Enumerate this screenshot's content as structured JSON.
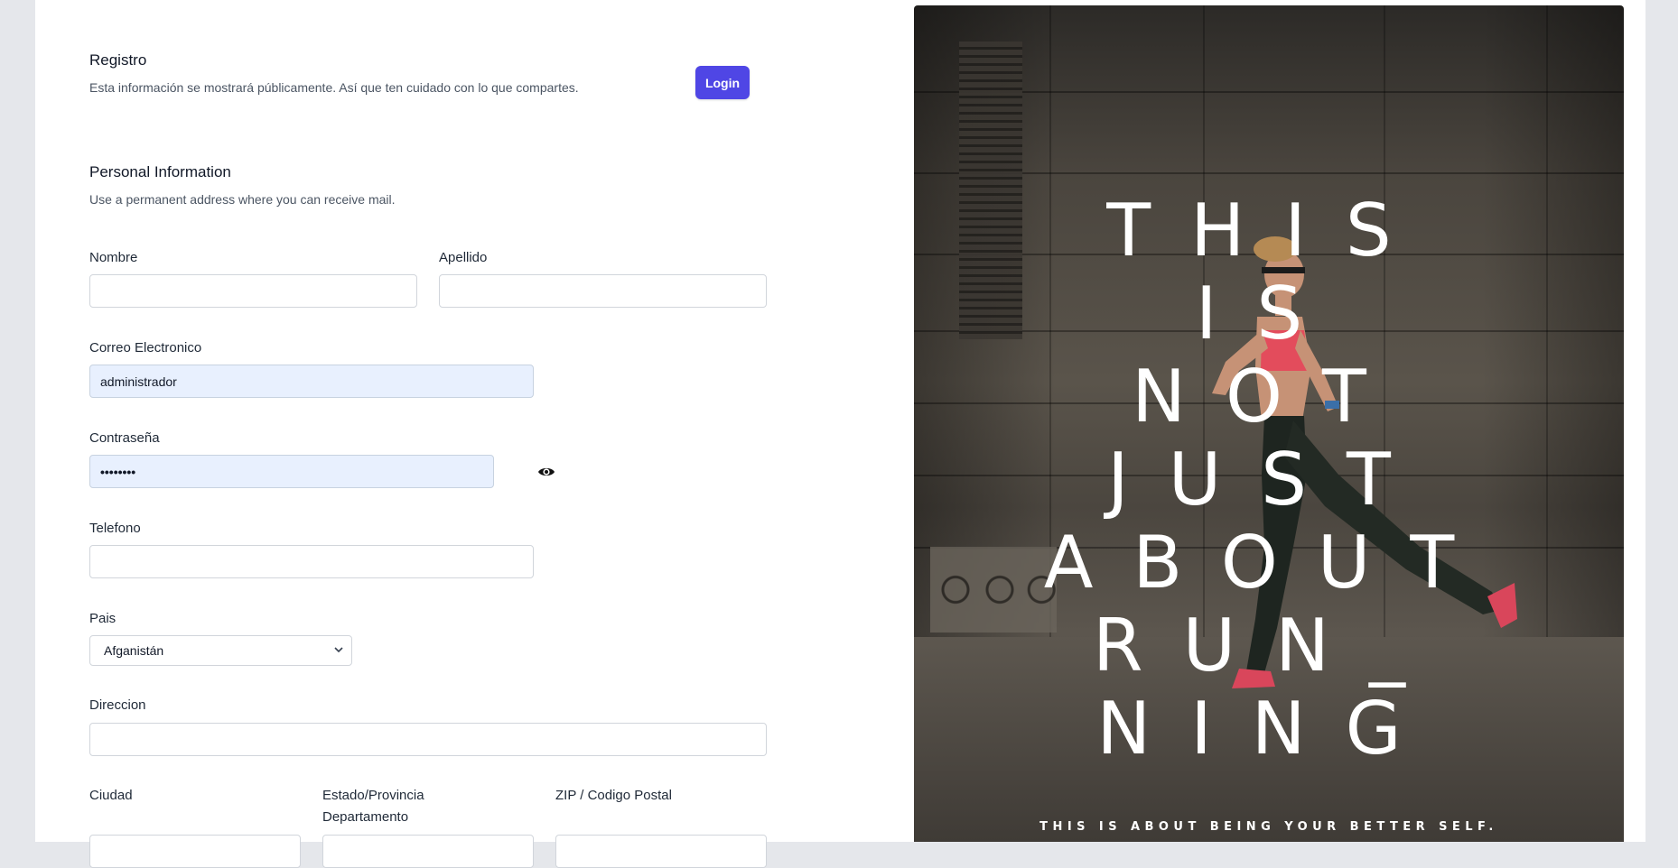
{
  "header": {
    "title": "Registro",
    "subtitle": "Esta información se mostrará públicamente. Así que ten cuidado con lo que compartes.",
    "login_label": "Login"
  },
  "section": {
    "title": "Personal Information",
    "subtitle": "Use a permanent address where you can receive mail."
  },
  "fields": {
    "nombre": {
      "label": "Nombre",
      "value": ""
    },
    "apellido": {
      "label": "Apellido",
      "value": ""
    },
    "correo": {
      "label": "Correo Electronico",
      "value": "administrador"
    },
    "contrasena": {
      "label": "Contraseña",
      "value": "••••••••"
    },
    "telefono": {
      "label": "Telefono",
      "value": ""
    },
    "pais": {
      "label": "Pais",
      "value": "Afganistán"
    },
    "direccion": {
      "label": "Direccion",
      "value": ""
    },
    "ciudad": {
      "label": "Ciudad",
      "value": ""
    },
    "estado_line1": "Estado/Provincia",
    "estado_line2": "Departamento",
    "zip": {
      "label": "ZIP / Codigo Postal",
      "value": ""
    }
  },
  "icons": {
    "password_toggle": "eye-icon",
    "select_arrow": "chevron-down-icon"
  },
  "poster": {
    "lines": [
      "THIS",
      "IS",
      "NOT",
      "JUST",
      "ABOUT",
      "RUN_",
      "NING"
    ],
    "tagline": "THIS IS ABOUT BEING YOUR BETTER SELF."
  },
  "colors": {
    "accent": "#4f46e5",
    "autofill": "#e8f0fe",
    "background": "#e5e7eb"
  }
}
